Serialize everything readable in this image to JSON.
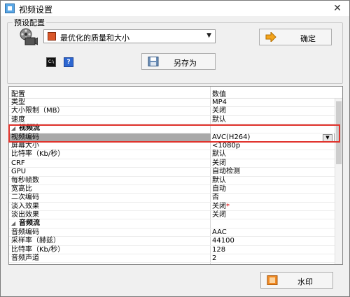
{
  "window": {
    "title": "视频设置"
  },
  "preset": {
    "group_label": "预设配置",
    "selected": "最优化的质量和大小",
    "ok_label": "确定",
    "saveas_label": "另存为"
  },
  "grid": {
    "col_name": "配置",
    "col_value": "数值",
    "rows": [
      {
        "type": "row",
        "name": "类型",
        "value": "MP4"
      },
      {
        "type": "row",
        "name": "大小限制（MB）",
        "value": "关闭"
      },
      {
        "type": "row",
        "name": "速度",
        "value": "默认"
      },
      {
        "type": "cat",
        "name": "视频流"
      },
      {
        "type": "row",
        "name": "视频编码",
        "value": "AVC(H264)",
        "selected": true
      },
      {
        "type": "row",
        "name": "屏幕大小",
        "value": "<1080p"
      },
      {
        "type": "row",
        "name": "比特率（Kb/秒）",
        "value": "默认"
      },
      {
        "type": "row",
        "name": "CRF",
        "value": "关闭"
      },
      {
        "type": "row",
        "name": "GPU",
        "value": "自动检测"
      },
      {
        "type": "row",
        "name": "每秒帧数",
        "value": "默认"
      },
      {
        "type": "row",
        "name": "宽高比",
        "value": "自动"
      },
      {
        "type": "row",
        "name": "二次编码",
        "value": "否"
      },
      {
        "type": "row",
        "name": "淡入效果",
        "value": "关闭",
        "marker": "*"
      },
      {
        "type": "row",
        "name": "淡出效果",
        "value": "关闭"
      },
      {
        "type": "cat",
        "name": "音频流"
      },
      {
        "type": "row",
        "name": "音频编码",
        "value": "AAC"
      },
      {
        "type": "row",
        "name": "采样率（赫兹）",
        "value": "44100"
      },
      {
        "type": "row",
        "name": "比特率（Kb/秒）",
        "value": "128"
      },
      {
        "type": "row",
        "name": "音频声道",
        "value": "2"
      }
    ]
  },
  "footer": {
    "watermark_label": "水印"
  },
  "icons": {
    "app": "video-settings-icon",
    "film": "film-reel-icon",
    "preset": "preset-icon",
    "ok": "arrow-right-icon",
    "save": "save-disk-icon",
    "cmd": "command-line-icon",
    "help": "help-icon",
    "watermark": "watermark-icon"
  },
  "colors": {
    "highlight": "#e0322b",
    "selected_row": "#a9a9a9"
  }
}
